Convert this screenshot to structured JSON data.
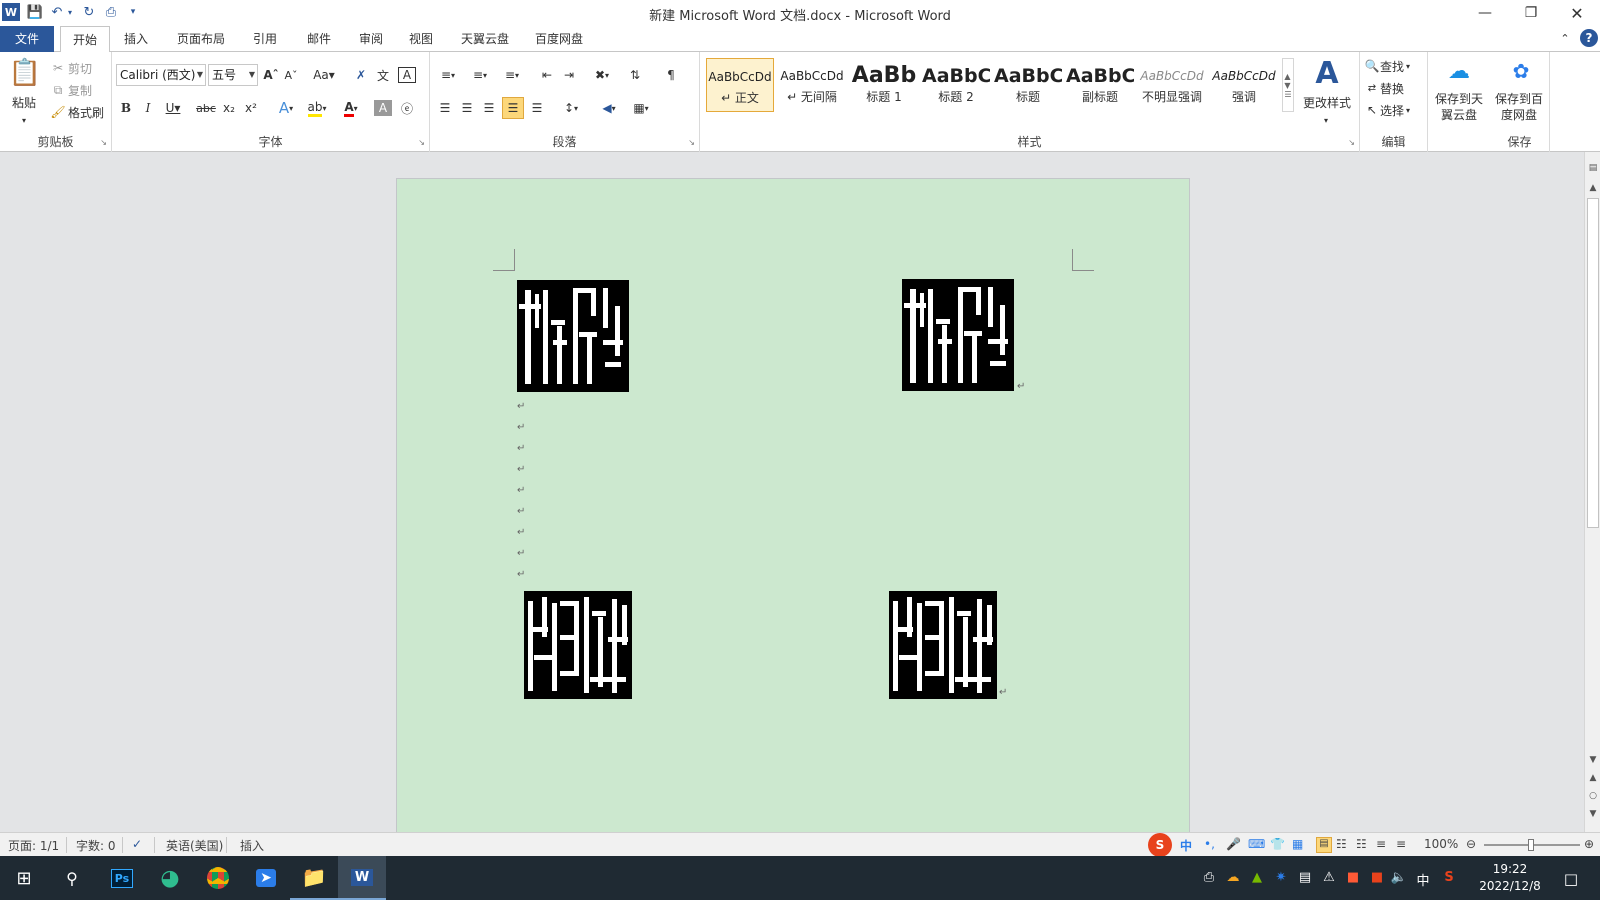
{
  "window": {
    "title": "新建 Microsoft Word 文档.docx - Microsoft Word"
  },
  "ribbon_tabs": [
    "文件",
    "开始",
    "插入",
    "页面布局",
    "引用",
    "邮件",
    "审阅",
    "视图",
    "天翼云盘",
    "百度网盘"
  ],
  "clipboard": {
    "paste": "粘贴",
    "cut": "剪切",
    "copy": "复制",
    "format_painter": "格式刷",
    "label": "剪贴板"
  },
  "font": {
    "name": "Calibri (西文)",
    "size": "五号",
    "label": "字体"
  },
  "paragraph": {
    "label": "段落"
  },
  "styles": {
    "items": [
      {
        "preview": "AaBbCcDd",
        "name": "↵ 正文"
      },
      {
        "preview": "AaBbCcDd",
        "name": "↵ 无间隔"
      },
      {
        "preview": "AaBb",
        "name": "标题 1"
      },
      {
        "preview": "AaBbC",
        "name": "标题 2"
      },
      {
        "preview": "AaBbC",
        "name": "标题"
      },
      {
        "preview": "AaBbC",
        "name": "副标题"
      },
      {
        "preview": "AaBbCcDd",
        "name": "不明显强调"
      },
      {
        "preview": "AaBbCcDd",
        "name": "强调"
      }
    ],
    "change": "更改样式",
    "label": "样式"
  },
  "editing": {
    "find": "查找",
    "replace": "替换",
    "select": "选择",
    "label": "编辑"
  },
  "cloud": {
    "tianyi": "保存到天翼云盘",
    "baidu": "保存到百度网盘",
    "label": "保存"
  },
  "status": {
    "page": "页面: 1/1",
    "words": "字数: 0",
    "language": "英语(美国)",
    "mode": "插入",
    "zoom": "100%",
    "ime": "中"
  },
  "tray": {
    "time": "19:22",
    "date": "2022/12/8",
    "ime": "中"
  },
  "colors": {
    "word_blue": "#2b579a",
    "page_bg": "#cce8cf",
    "workspace": "#e3e4e6",
    "taskbar": "#1f2a33"
  }
}
